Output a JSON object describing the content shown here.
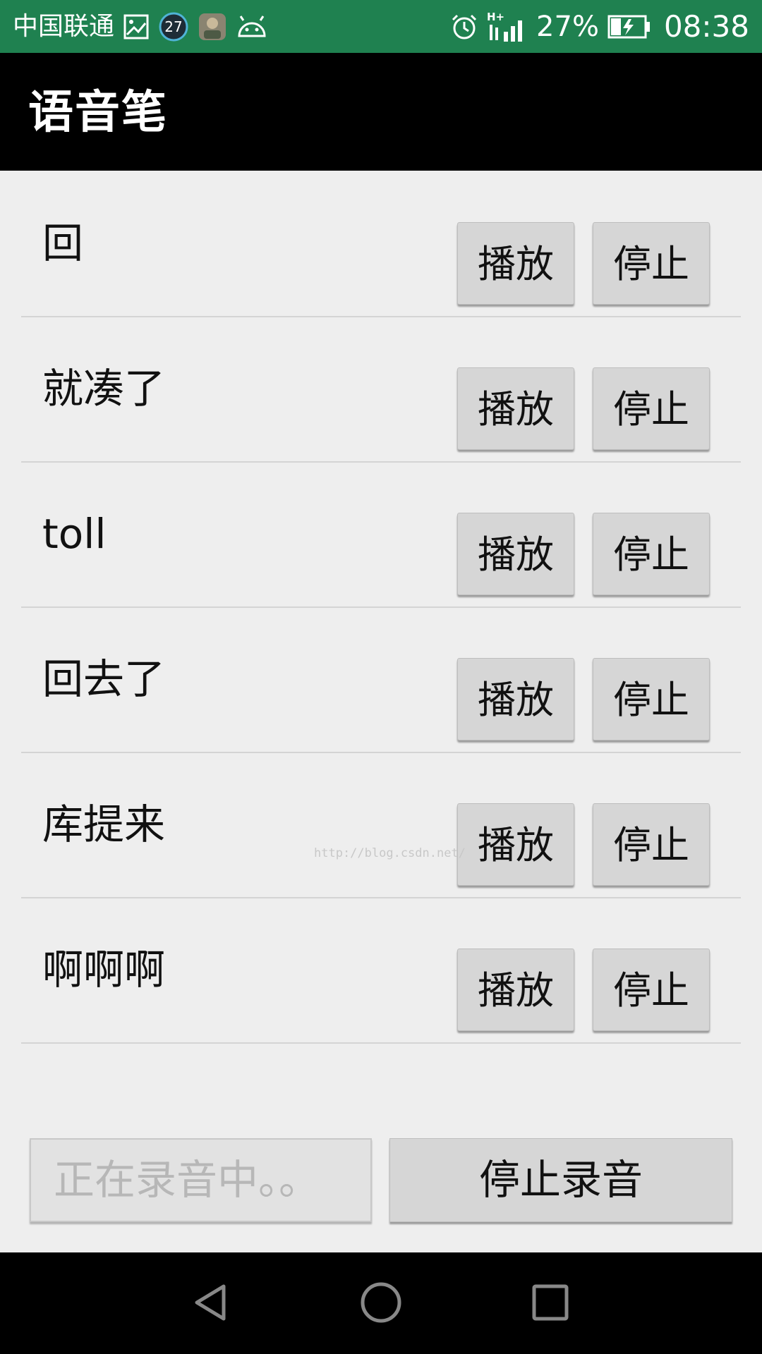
{
  "status_bar": {
    "carrier": "中国联通",
    "notification_badge": "27",
    "network": "H+",
    "battery": "27%",
    "time": "08:38",
    "icons": [
      "gallery-icon",
      "badge-27-icon",
      "avatar-icon",
      "android-icon",
      "alarm-icon",
      "signal-icon",
      "battery-charging-icon"
    ]
  },
  "app": {
    "title": "语音笔"
  },
  "recordings": [
    {
      "label": "回",
      "play": "播放",
      "stop": "停止"
    },
    {
      "label": "就凑了",
      "play": "播放",
      "stop": "停止"
    },
    {
      "label": "toll",
      "play": "播放",
      "stop": "停止"
    },
    {
      "label": "回去了",
      "play": "播放",
      "stop": "停止"
    },
    {
      "label": "库提来",
      "play": "播放",
      "stop": "停止"
    },
    {
      "label": "啊啊啊",
      "play": "播放",
      "stop": "停止"
    }
  ],
  "watermark": "http://blog.csdn.net/",
  "bottom": {
    "status_text": "正在录音中。。",
    "stop_record_label": "停止录音"
  },
  "nav": {
    "icons": [
      "back-icon",
      "home-icon",
      "recent-apps-icon"
    ]
  },
  "colors": {
    "status_bar": "#1f8150",
    "action_bar": "#000000",
    "content_bg": "#eeeeee",
    "button_bg": "#d6d6d6"
  }
}
